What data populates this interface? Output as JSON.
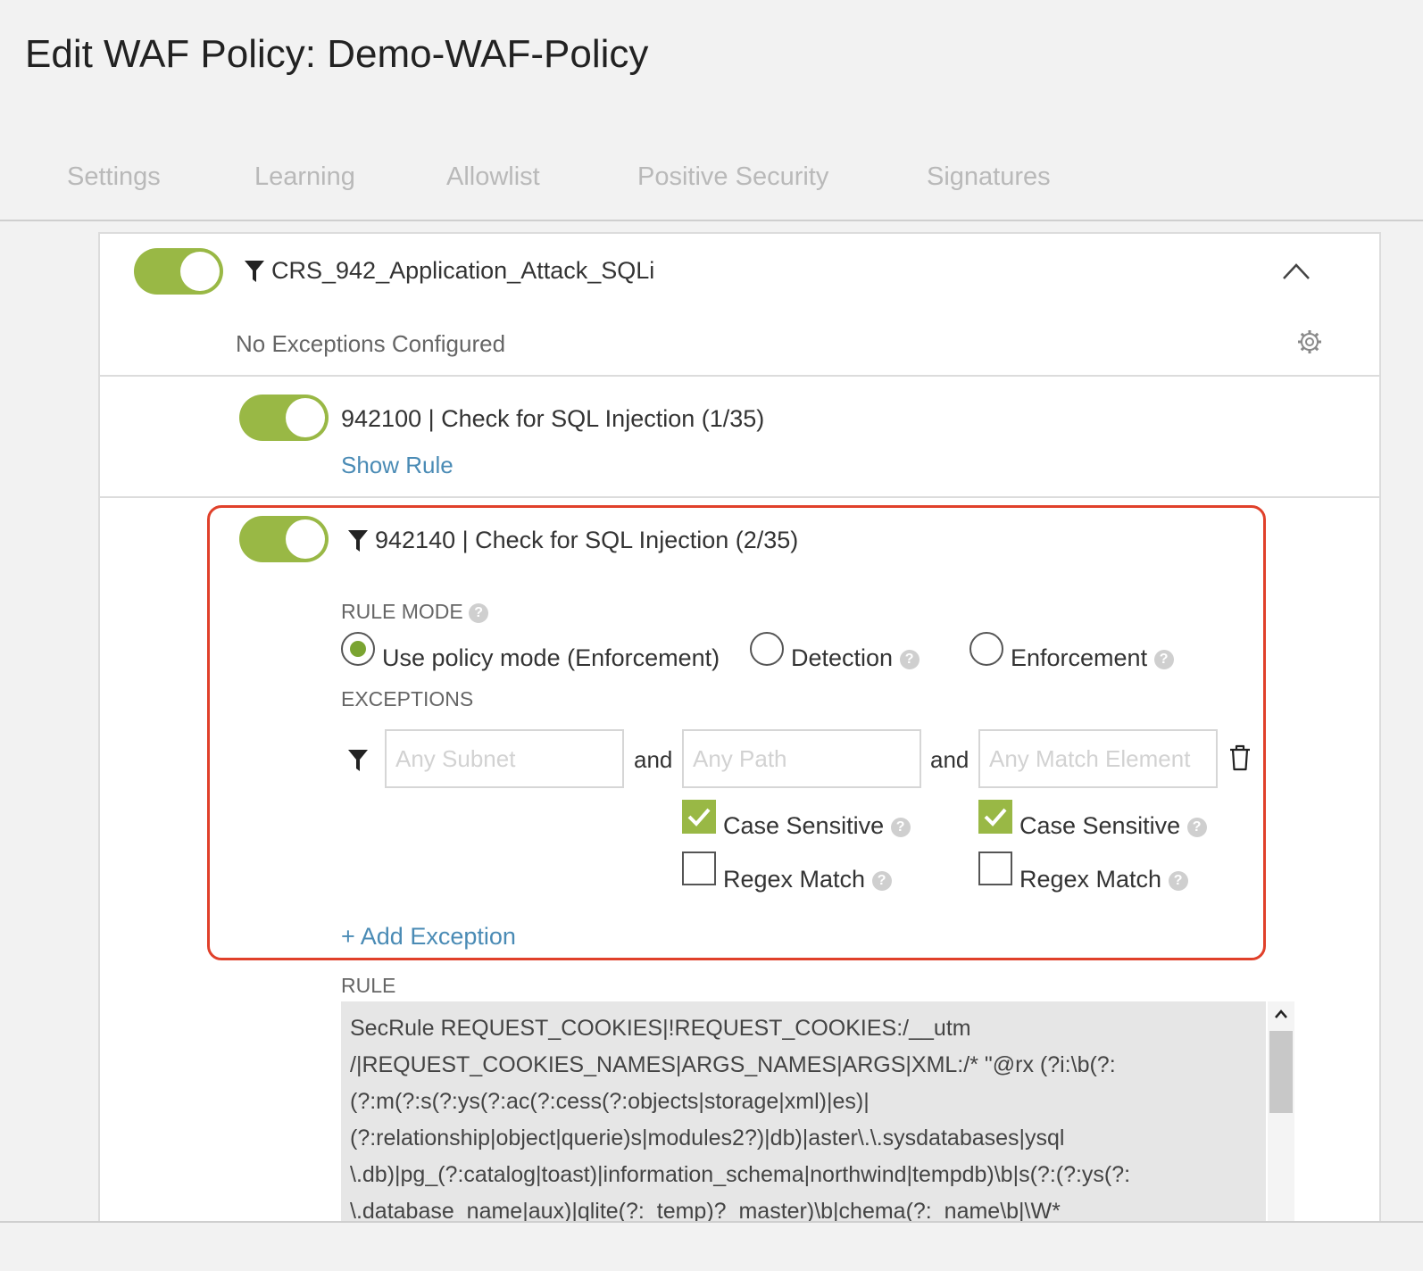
{
  "page": {
    "title": "Edit WAF Policy: Demo-WAF-Policy"
  },
  "tabs": [
    {
      "label": "Settings"
    },
    {
      "label": "Learning"
    },
    {
      "label": "Allowlist"
    },
    {
      "label": "Positive Security"
    },
    {
      "label": "Signatures"
    }
  ],
  "group": {
    "name": "CRS_942_Application_Attack_SQLi",
    "enabled": true,
    "exceptions_status": "No Exceptions Configured"
  },
  "rules": [
    {
      "title": "942100 | Check for SQL Injection (1/35)",
      "enabled": true,
      "show_rule_label": "Show Rule"
    },
    {
      "title": "942140 | Check for SQL Injection (2/35)",
      "enabled": true,
      "rule_mode_label": "RULE MODE",
      "modes": [
        {
          "label": "Use policy mode (Enforcement)",
          "selected": true
        },
        {
          "label": "Detection",
          "selected": false
        },
        {
          "label": "Enforcement",
          "selected": false
        }
      ],
      "exceptions_label": "EXCEPTIONS",
      "exception": {
        "subnet_placeholder": "Any Subnet",
        "path_placeholder": "Any Path",
        "match_placeholder": "Any Match Element",
        "and_label": "and",
        "path_case_sensitive": {
          "label": "Case Sensitive",
          "checked": true
        },
        "path_regex": {
          "label": "Regex Match",
          "checked": false
        },
        "match_case_sensitive": {
          "label": "Case Sensitive",
          "checked": true
        },
        "match_regex": {
          "label": "Regex Match",
          "checked": false
        }
      },
      "add_exception_label": "+ Add Exception",
      "rule_label": "RULE",
      "rule_text_lines": [
        "SecRule REQUEST_COOKIES|!REQUEST_COOKIES:/__utm",
        "/|REQUEST_COOKIES_NAMES|ARGS_NAMES|ARGS|XML:/* \"@rx (?i:\\b(?:",
        "(?:m(?:s(?:ys(?:ac(?:cess(?:objects|storage|xml)|es)|",
        "(?:relationship|object|querie)s|modules2?)|db)|aster\\.\\.sysdatabases|ysql",
        "\\.db)|pg_(?:catalog|toast)|information_schema|northwind|tempdb)\\b|s(?:(?:ys(?:",
        "\\.database_name|aux)|qlite(?:_temp)?_master)\\b|chema(?:_name\\b|\\W*"
      ]
    }
  ],
  "colors": {
    "accent": "#99b845",
    "link": "#4a8bb5",
    "highlight": "#e0402a"
  }
}
